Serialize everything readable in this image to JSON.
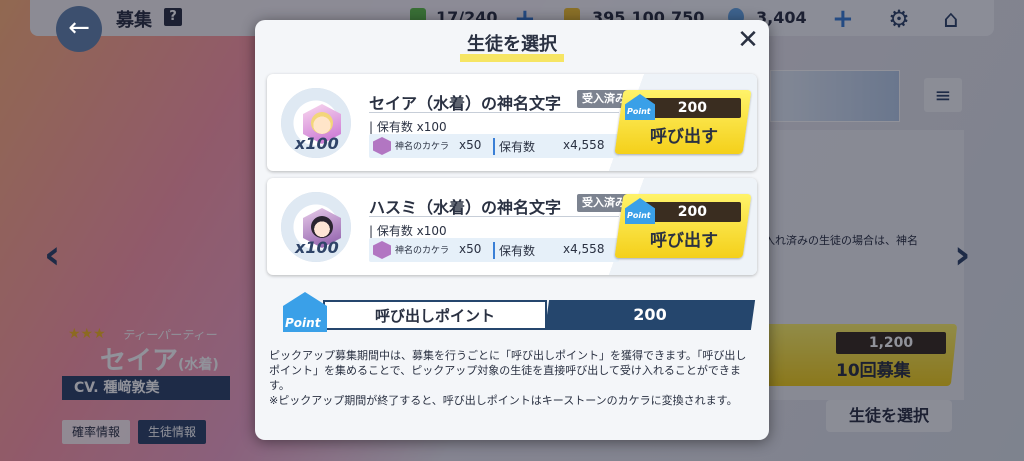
{
  "background": {
    "page_title": "募集",
    "help_label": "?",
    "res_ap": "17/240",
    "res_credits": "395,100,750",
    "res_pyroxene": "3,404",
    "plus_label": "+",
    "settings_icon": "gear-icon",
    "home_icon": "home-icon",
    "back_icon": "back-arrow-icon",
    "left_arrow": "‹",
    "right_arrow": "›",
    "char_stars": "★★★",
    "char_type": "ティーパーティー",
    "char_name": "セイア",
    "char_sub": "(水着)",
    "cv": "CV. 種﨑敦美",
    "tab_rates": "確率情報",
    "tab_student": "生徒情報",
    "right_panel_text": "入れ済みの生徒の場合は、神名",
    "gacha_cost": "1,200",
    "gacha_label": "10回募集",
    "pick_button": "生徒を選択",
    "menu_label": "≡"
  },
  "modal": {
    "title": "生徒を選択",
    "close_label": "✕",
    "cards": [
      {
        "name": "セイア（水着）の神名文字",
        "badge": "受入済み",
        "medal_count": "x100",
        "owned_text": "| 保有数 x100",
        "kakera_label": "神名のカケラ",
        "kakera_x": "x50",
        "kakera_held_label": "保有数",
        "kakera_held": "x4,558",
        "cost": "200",
        "point_label": "Point",
        "call_label": "呼び出す"
      },
      {
        "name": "ハスミ（水着）の神名文字",
        "badge": "受入済み",
        "medal_count": "x100",
        "owned_text": "| 保有数 x100",
        "kakera_label": "神名のカケラ",
        "kakera_x": "x50",
        "kakera_held_label": "保有数",
        "kakera_held": "x4,558",
        "cost": "200",
        "point_label": "Point",
        "call_label": "呼び出す"
      }
    ],
    "points": {
      "icon_label": "Point",
      "label": "呼び出しポイント",
      "value": "200"
    },
    "description": [
      "ピックアップ募集期間中は、募集を行うごとに「呼び出しポイント」を獲得できます。「呼び出しポイント」を集めることで、ピックアップ対象の生徒を直接呼び出して受け入れることができます。",
      "※ピックアップ期間が終了すると、呼び出しポイントはキーストーンのカケラに変換されます。"
    ]
  },
  "colors": {
    "accent_yellow": "#f4d01a",
    "navy": "#25466d",
    "point_blue": "#3aa0e8"
  }
}
